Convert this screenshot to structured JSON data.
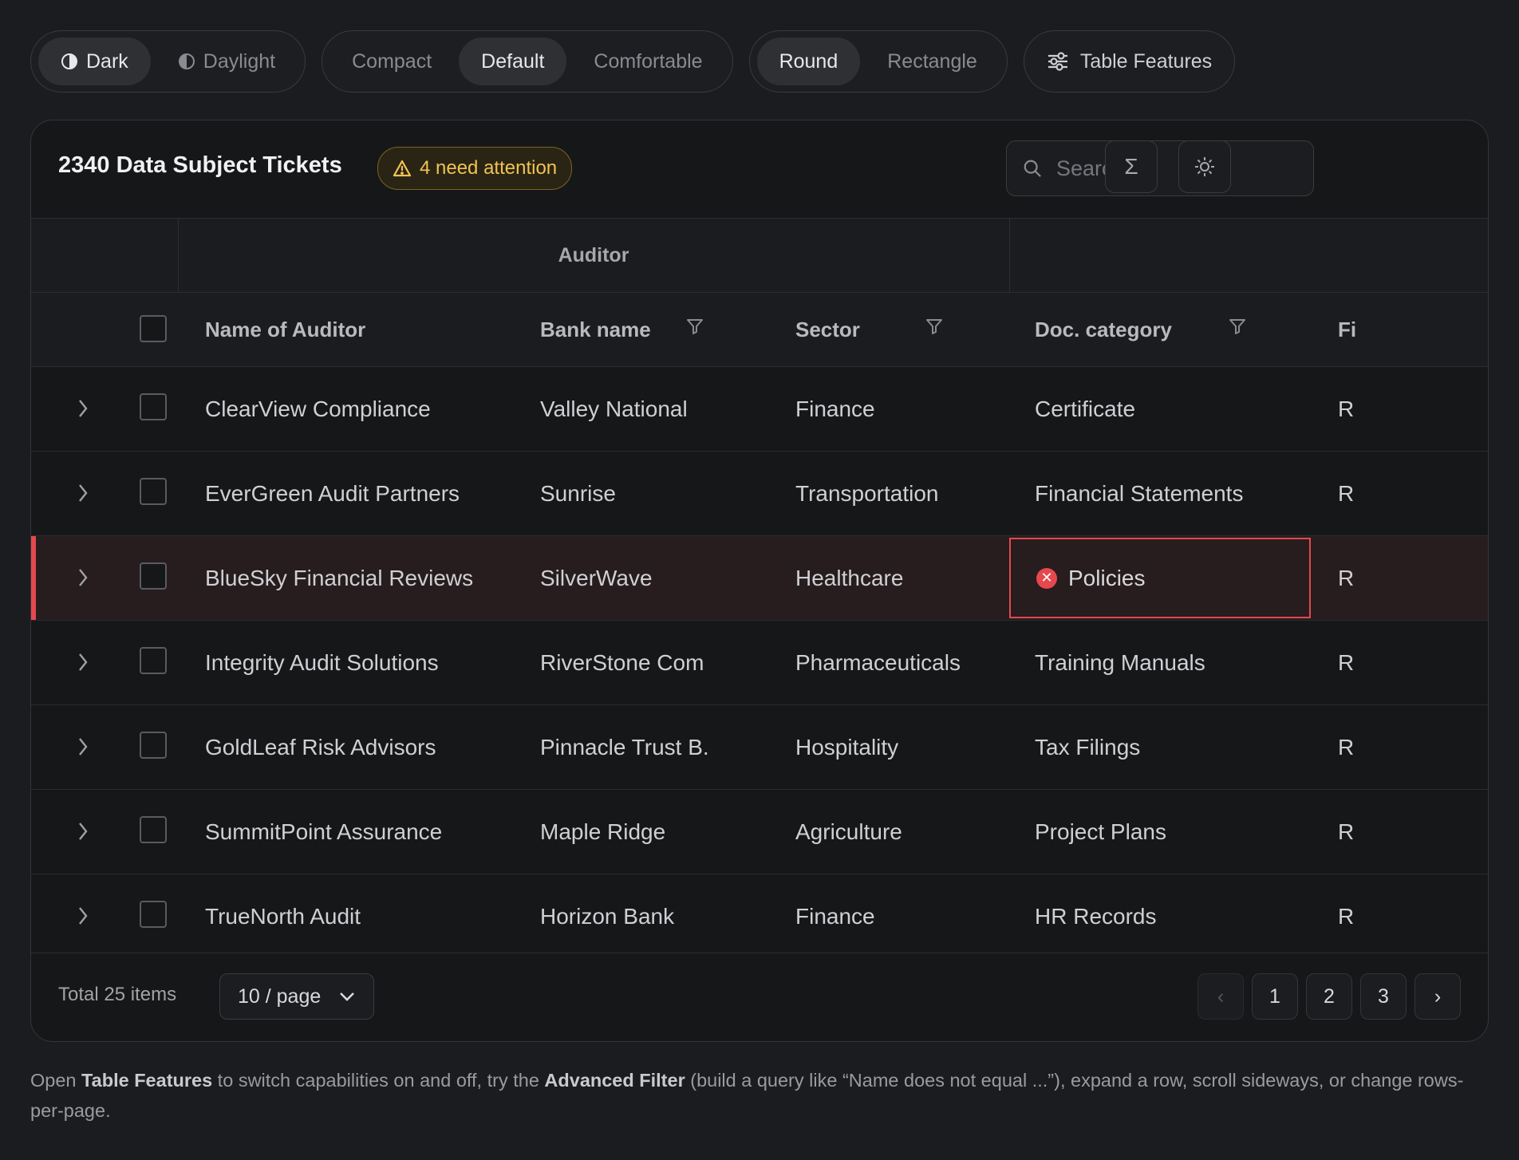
{
  "toolbar": {
    "theme": [
      {
        "label": "Dark",
        "icon": "half-circle-icon",
        "active": true
      },
      {
        "label": "Daylight",
        "icon": "half-circle-icon",
        "active": false
      }
    ],
    "density": [
      {
        "label": "Compact",
        "active": false
      },
      {
        "label": "Default",
        "active": true
      },
      {
        "label": "Comfortable",
        "active": false
      }
    ],
    "shape": [
      {
        "label": "Round",
        "active": true
      },
      {
        "label": "Rectangle",
        "active": false
      }
    ],
    "features_label": "Table Features"
  },
  "header": {
    "title": "2340 Data Subject Tickets",
    "attention_badge": "4 need attention",
    "search_placeholder": "Search"
  },
  "table": {
    "group_header": "Auditor",
    "columns": {
      "name": "Name of Auditor",
      "bank": "Bank name",
      "sector": "Sector",
      "doc": "Doc. category",
      "fi": "Fi"
    },
    "rows": [
      {
        "name": "ClearView Compliance",
        "bank": "Valley National",
        "sector": "Finance",
        "doc": "Certificate",
        "fi": "R",
        "error": false
      },
      {
        "name": "EverGreen Audit Partners",
        "bank": "Sunrise",
        "sector": "Transportation",
        "doc": "Financial Statements",
        "fi": "R",
        "error": false
      },
      {
        "name": "BlueSky Financial Reviews",
        "bank": "SilverWave",
        "sector": "Healthcare",
        "doc": "Policies",
        "fi": "R",
        "error": true
      },
      {
        "name": "Integrity Audit Solutions",
        "bank": "RiverStone Com",
        "sector": "Pharmaceuticals",
        "doc": "Training Manuals",
        "fi": "R",
        "error": false
      },
      {
        "name": "GoldLeaf Risk Advisors",
        "bank": "Pinnacle Trust B.",
        "sector": "Hospitality",
        "doc": "Tax Filings",
        "fi": "R",
        "error": false
      },
      {
        "name": "SummitPoint Assurance",
        "bank": "Maple Ridge",
        "sector": "Agriculture",
        "doc": "Project Plans",
        "fi": "R",
        "error": false
      },
      {
        "name": "TrueNorth Audit",
        "bank": "Horizon Bank",
        "sector": "Finance",
        "doc": "HR Records",
        "fi": "R",
        "error": false
      }
    ]
  },
  "footer": {
    "total": "Total 25 items",
    "page_size": "10 / page",
    "pages": [
      "1",
      "2",
      "3"
    ],
    "prev": "‹",
    "next": "›"
  },
  "help": {
    "p1": "Open ",
    "b1": "Table Features",
    "p2": " to switch capabilities on and off, try the ",
    "b2": "Advanced Filter",
    "p3": " (build a query like “Name does not equal ...”), expand a row, scroll sideways, or change rows-per-page."
  },
  "colors": {
    "background": "#1b1c1f",
    "card": "#161719",
    "error": "#e5484d",
    "warning": "#f0c453"
  }
}
